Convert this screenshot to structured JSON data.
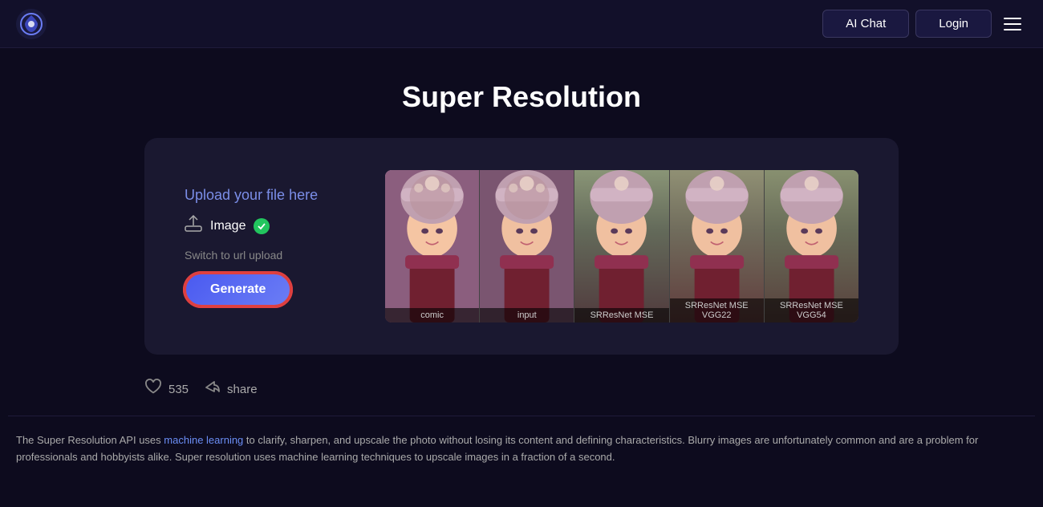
{
  "navbar": {
    "logo_symbol": "◑",
    "ai_chat_label": "AI Chat",
    "login_label": "Login"
  },
  "page": {
    "title": "Super Resolution"
  },
  "upload_panel": {
    "upload_label": "Upload your file here",
    "image_label": "Image",
    "switch_url_label": "Switch to url upload",
    "generate_label": "Generate"
  },
  "image_segments": [
    {
      "label": "comic"
    },
    {
      "label": "input"
    },
    {
      "label": "SRResNet MSE"
    },
    {
      "label": "SRResNet MSE VGG22"
    },
    {
      "label": "SRResNet MSE VGG54"
    }
  ],
  "actions": {
    "like_count": "535",
    "share_label": "share"
  },
  "description": {
    "text_before_link": "The Super Resolution API uses ",
    "link_text": "machine learning",
    "text_after_link": " to clarify, sharpen, and upscale the photo without losing its content and defining characteristics. Blurry images are unfortunately common and are a problem for professionals and hobbyists alike. Super resolution uses machine learning techniques to upscale images in a fraction of a second."
  }
}
